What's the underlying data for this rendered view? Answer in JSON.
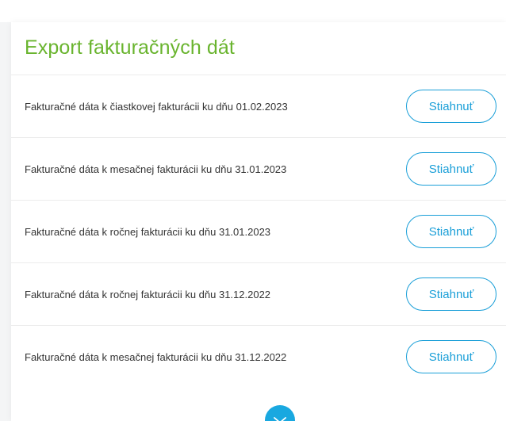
{
  "card": {
    "title": "Export fakturačných dát"
  },
  "rows": [
    {
      "label": "Fakturačné dáta k čiastkovej fakturácii ku dňu 01.02.2023",
      "button": "Stiahnuť"
    },
    {
      "label": "Fakturačné dáta k mesačnej fakturácii ku dňu 31.01.2023",
      "button": "Stiahnuť"
    },
    {
      "label": "Fakturačné dáta k ročnej fakturácii ku dňu 31.01.2023",
      "button": "Stiahnuť"
    },
    {
      "label": "Fakturačné dáta k ročnej fakturácii ku dňu 31.12.2022",
      "button": "Stiahnuť"
    },
    {
      "label": "Fakturačné dáta k mesačnej fakturácii ku dňu 31.12.2022",
      "button": "Stiahnuť"
    }
  ],
  "expand": {
    "icon": "chevron-down-icon"
  },
  "colors": {
    "title": "#69b42e",
    "accent": "#1a9fd8",
    "expand_bg": "#19a8e0"
  }
}
